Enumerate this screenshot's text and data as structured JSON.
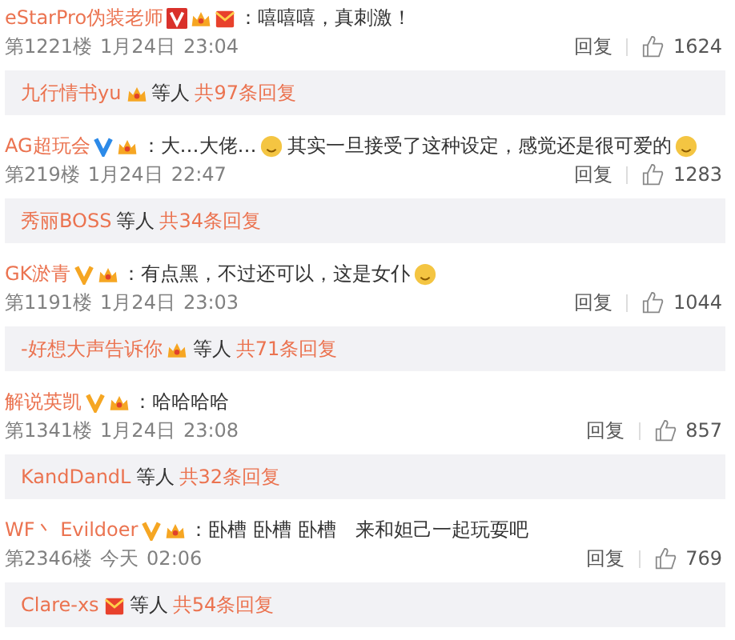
{
  "comments": [
    {
      "user": "eStarPro伪装老师",
      "badges": [
        {
          "kind": "vred"
        },
        {
          "kind": "member"
        },
        {
          "kind": "envelope"
        }
      ],
      "content": [
        {
          "kind": "text",
          "text": "：嘻嘻嘻，真刺激！"
        }
      ],
      "floor": "第1221楼",
      "date": "1月24日",
      "time": "23:04",
      "reply_label": "回复",
      "likes": "1624",
      "replies": {
        "user": "九行情书yu",
        "badges": [
          {
            "kind": "member"
          }
        ],
        "others": "等人",
        "count": "共97条回复"
      }
    },
    {
      "user": "AG超玩会",
      "badges": [
        {
          "kind": "vblue"
        },
        {
          "kind": "member"
        }
      ],
      "content": [
        {
          "kind": "text",
          "text": "：大…大佬…"
        },
        {
          "kind": "emoji"
        },
        {
          "kind": "text",
          "text": "其实一旦接受了这种设定，感觉还是很可爱的"
        },
        {
          "kind": "emoji"
        }
      ],
      "floor": "第219楼",
      "date": "1月24日",
      "time": "22:47",
      "reply_label": "回复",
      "likes": "1283",
      "replies": {
        "user": "秀丽BOSS",
        "others": "等人",
        "count": "共34条回复"
      }
    },
    {
      "user": "GK淤青",
      "badges": [
        {
          "kind": "vorange"
        },
        {
          "kind": "member"
        }
      ],
      "content": [
        {
          "kind": "text",
          "text": "：有点黑，不过还可以，这是女仆"
        },
        {
          "kind": "emoji"
        }
      ],
      "floor": "第1191楼",
      "date": "1月24日",
      "time": "23:03",
      "reply_label": "回复",
      "likes": "1044",
      "replies": {
        "user": "-好想大声告诉你",
        "badges": [
          {
            "kind": "member"
          }
        ],
        "others": "等人",
        "count": "共71条回复"
      }
    },
    {
      "user": "解说英凯",
      "badges": [
        {
          "kind": "vorange"
        },
        {
          "kind": "member"
        }
      ],
      "content": [
        {
          "kind": "text",
          "text": "：哈哈哈哈"
        }
      ],
      "floor": "第1341楼",
      "date": "1月24日",
      "time": "23:08",
      "reply_label": "回复",
      "likes": "857",
      "replies": {
        "user": "KandDandL",
        "others": "等人",
        "count": "共32条回复"
      }
    },
    {
      "user": "WF丶 Evildoer",
      "badges": [
        {
          "kind": "vorange"
        },
        {
          "kind": "member"
        }
      ],
      "content": [
        {
          "kind": "text",
          "text": "：卧槽 卧槽 卧槽　来和妲己一起玩耍吧"
        }
      ],
      "floor": "第2346楼",
      "date": "今天",
      "time": "02:06",
      "reply_label": "回复",
      "likes": "769",
      "replies": {
        "user": "Clare-xs",
        "badges": [
          {
            "kind": "envelope"
          }
        ],
        "others": "等人",
        "count": "共54条回复"
      }
    }
  ]
}
